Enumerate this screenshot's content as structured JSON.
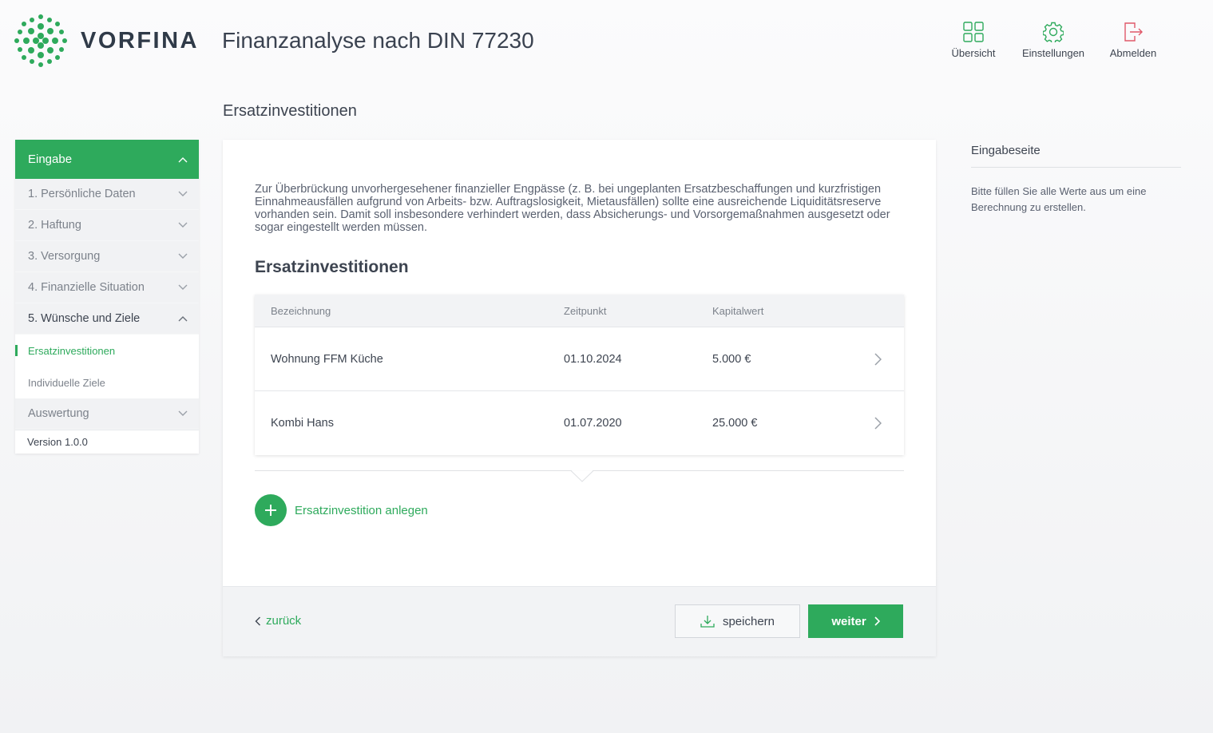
{
  "brand": {
    "name": "VORFINA",
    "accent": "#2eaa5c"
  },
  "header": {
    "title": "Finanzanalyse nach DIN 77230",
    "nav": [
      {
        "label": "Übersicht",
        "icon": "grid-icon"
      },
      {
        "label": "Einstellungen",
        "icon": "gear-icon"
      },
      {
        "label": "Abmelden",
        "icon": "logout-icon"
      }
    ]
  },
  "page": {
    "heading": "Ersatzinvestitionen"
  },
  "sidebar": {
    "head": "Eingabe",
    "items": [
      {
        "label": "1. Persönliche Daten"
      },
      {
        "label": "2. Haftung"
      },
      {
        "label": "3. Versorgung"
      },
      {
        "label": "4. Finanzielle Situation"
      },
      {
        "label": "5. Wünsche und Ziele"
      }
    ],
    "subitems": [
      {
        "label": "Ersatzinvestitionen",
        "active": true
      },
      {
        "label": "Individuelle Ziele",
        "active": false
      }
    ],
    "evaluation": "Auswertung",
    "version": "Version 1.0.0"
  },
  "main": {
    "intro": "Zur Überbrückung unvorhergesehener finanzieller Engpässe (z. B. bei ungeplanten Ersatzbeschaffungen und kurzfristigen Einnahmeausfällen aufgrund von Arbeits- bzw. Auftragslosigkeit, Mietausfällen) sollte eine ausreichende Liquiditätsreserve vorhanden sein. Damit soll insbesondere verhindert werden, dass Absicherungs- und Vorsorgemaßnahmen ausgesetzt oder sogar eingestellt werden müssen.",
    "section_title": "Ersatzinvestitionen",
    "table": {
      "headers": [
        "Bezeichnung",
        "Zeitpunkt",
        "Kapitalwert"
      ],
      "rows": [
        [
          "Wohnung FFM Küche",
          "01.10.2024",
          "5.000 €"
        ],
        [
          "Kombi Hans",
          "01.07.2020",
          "25.000 €"
        ]
      ]
    },
    "add_label": "Ersatzinvestition anlegen",
    "footer": {
      "back": "zurück",
      "save": "speichern",
      "next": "weiter"
    }
  },
  "aside": {
    "title": "Eingabeseite",
    "text": "Bitte füllen Sie alle Werte aus um eine Berechnung zu erstellen."
  }
}
